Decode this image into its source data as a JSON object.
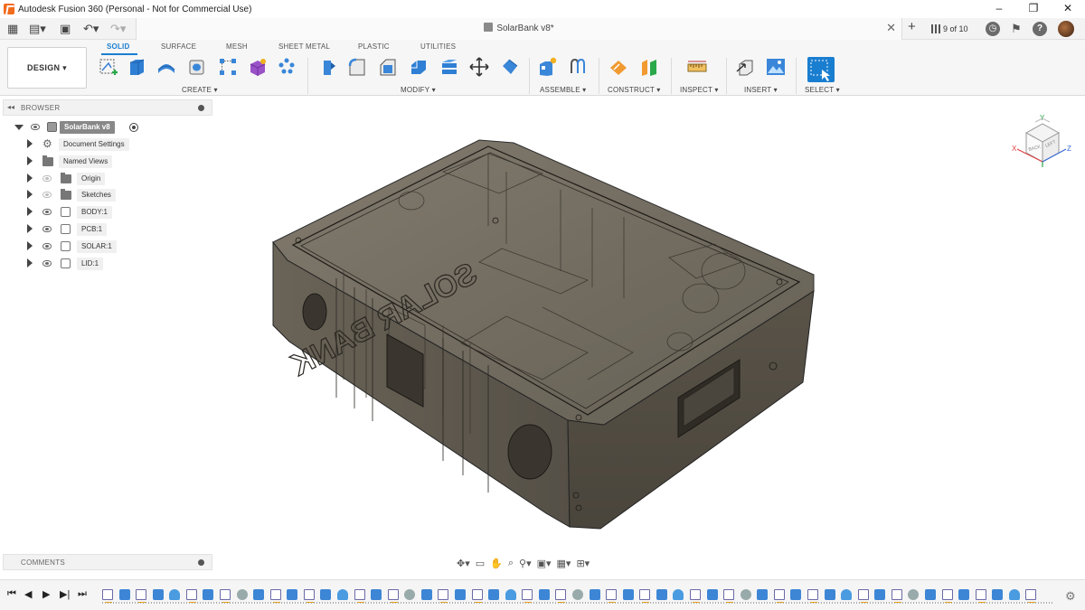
{
  "window": {
    "title": "Autodesk Fusion 360 (Personal - Not for Commercial Use)",
    "controls": [
      "–",
      "❐",
      "✕"
    ]
  },
  "appbar": {
    "document_title": "SolarBank v8*",
    "close": "✕",
    "add": "+",
    "job_status": "9 of 10"
  },
  "toolbar": {
    "workspace": "DESIGN ▾",
    "tabs": [
      "SOLID",
      "SURFACE",
      "MESH",
      "SHEET METAL",
      "PLASTIC",
      "UTILITIES"
    ],
    "active_tab": "SOLID",
    "groups": {
      "create": "CREATE ▾",
      "modify": "MODIFY ▾",
      "assemble": "ASSEMBLE ▾",
      "construct": "CONSTRUCT ▾",
      "inspect": "INSPECT ▾",
      "insert": "INSERT ▾",
      "select": "SELECT ▾"
    },
    "accent": "#1a7ed0"
  },
  "browser": {
    "title": "BROWSER",
    "collapse": "◂◂",
    "root": "SolarBank v8",
    "nodes": [
      {
        "label": "Document Settings",
        "icon": "gear-icon"
      },
      {
        "label": "Named Views",
        "icon": "folder-icon"
      },
      {
        "label": "Origin",
        "icon": "folder-icon"
      },
      {
        "label": "Sketches",
        "icon": "folder-icon"
      },
      {
        "label": "BODY:1",
        "icon": "component-icon"
      },
      {
        "label": "PCB:1",
        "icon": "component-icon"
      },
      {
        "label": "SOLAR:1",
        "icon": "component-icon"
      },
      {
        "label": "LID:1",
        "icon": "component-icon"
      }
    ]
  },
  "comments": {
    "title": "COMMENTS"
  },
  "viewcube": {
    "faces": [
      "BACK",
      "LEFT"
    ],
    "axes": [
      "X",
      "Y",
      "Z"
    ]
  },
  "model": {
    "engraving": "SOLAR BANK",
    "color": "#5b544a"
  },
  "navbar": {
    "icons": [
      "orbit-icon",
      "look-at-icon",
      "pan-icon",
      "zoom-window-icon",
      "zoom-icon",
      "display-settings-icon",
      "grid-icon",
      "viewports-icon"
    ]
  },
  "timeline": {
    "controls": [
      "⏮",
      "◀",
      "▶",
      "▶|",
      "⏭"
    ],
    "item_count": 56
  }
}
